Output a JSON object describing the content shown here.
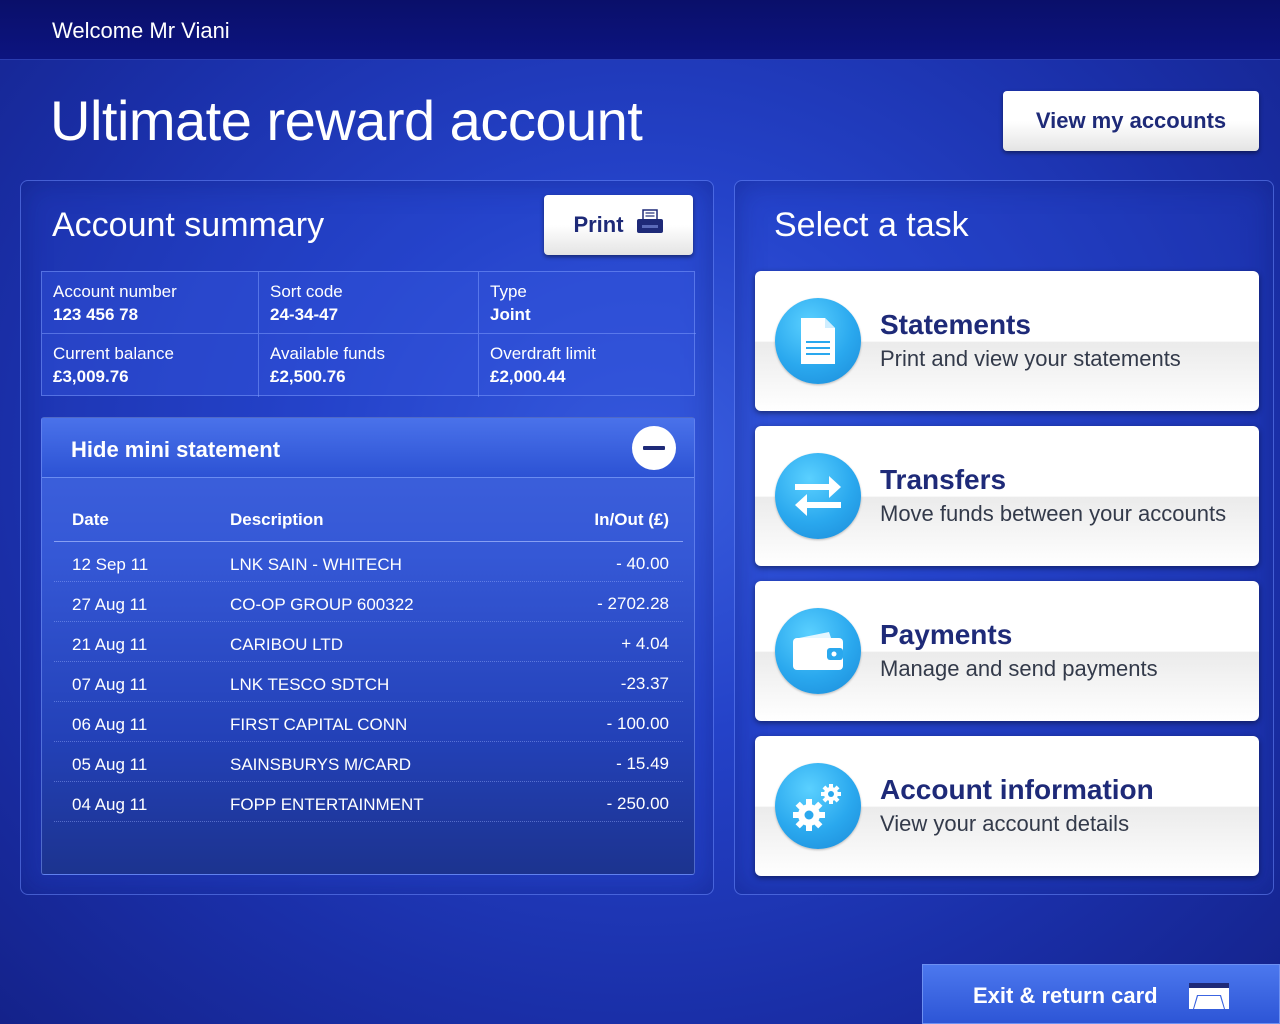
{
  "header": {
    "welcome": "Welcome Mr Viani"
  },
  "page_title": "Ultimate reward account",
  "view_accounts_label": "View my accounts",
  "summary": {
    "title": "Account summary",
    "print_label": "Print",
    "fields": [
      {
        "label": "Account number",
        "value": "123 456 78"
      },
      {
        "label": "Sort code",
        "value": "24-34-47"
      },
      {
        "label": "Type",
        "value": "Joint"
      },
      {
        "label": "Current balance",
        "value": "£3,009.76"
      },
      {
        "label": "Available funds",
        "value": "£2,500.76"
      },
      {
        "label": "Overdraft limit",
        "value": "£2,000.44"
      }
    ]
  },
  "mini_statement": {
    "toggle_label": "Hide mini statement",
    "columns": {
      "date": "Date",
      "description": "Description",
      "amount": "In/Out (£)"
    },
    "rows": [
      {
        "date": "12 Sep 11",
        "description": "LNK SAIN - WHITECH",
        "amount": "- 40.00"
      },
      {
        "date": "27 Aug 11",
        "description": "CO-OP GROUP 600322",
        "amount": "- 2702.28"
      },
      {
        "date": "21 Aug 11",
        "description": "CARIBOU LTD",
        "amount": "+ 4.04"
      },
      {
        "date": "07 Aug 11",
        "description": "LNK TESCO SDTCH",
        "amount": "-23.37"
      },
      {
        "date": "06 Aug 11",
        "description": "FIRST CAPITAL CONN",
        "amount": "- 100.00"
      },
      {
        "date": "05 Aug 11",
        "description": "SAINSBURYS M/CARD",
        "amount": "- 15.49"
      },
      {
        "date": "04 Aug 11",
        "description": "FOPP ENTERTAINMENT",
        "amount": "- 250.00"
      }
    ]
  },
  "tasks": {
    "title": "Select a task",
    "items": [
      {
        "name": "Statements",
        "description": "Print and view your statements",
        "icon": "document-icon"
      },
      {
        "name": "Transfers",
        "description": "Move funds between your accounts",
        "icon": "transfer-arrows-icon"
      },
      {
        "name": "Payments",
        "description": "Manage and send payments",
        "icon": "wallet-icon"
      },
      {
        "name": "Account information",
        "description": "View your account details",
        "icon": "gears-icon"
      }
    ]
  },
  "exit_label": "Exit & return card",
  "colors": {
    "accent_navy": "#1e2a78",
    "icon_blue": "#2aa8ee",
    "background_blue": "#2442c8"
  }
}
